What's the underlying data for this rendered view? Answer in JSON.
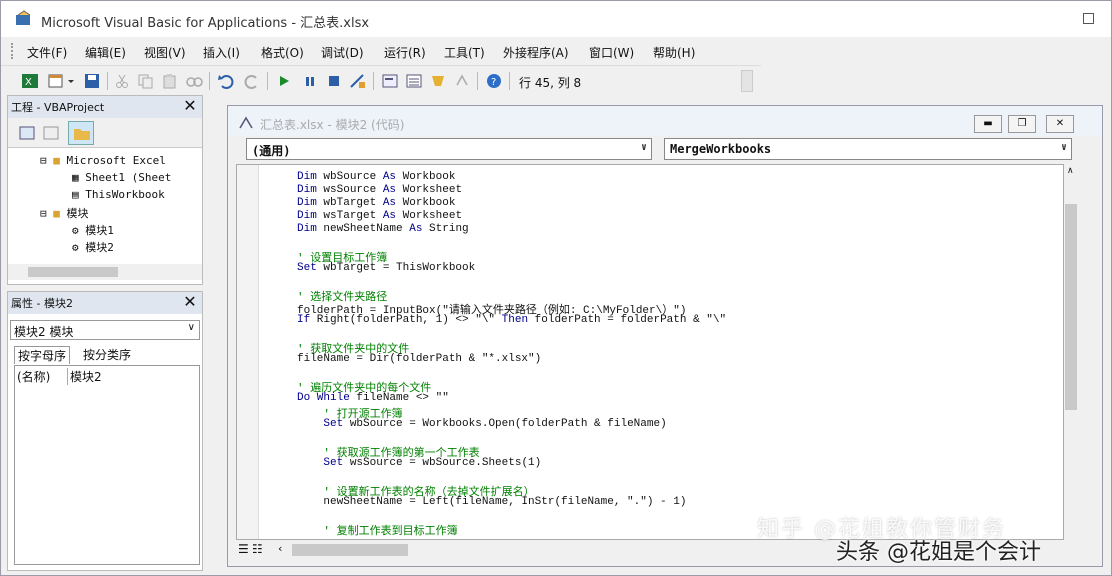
{
  "window": {
    "title": "Microsoft Visual Basic for Applications - 汇总表.xlsx"
  },
  "menu": [
    "文件(F)",
    "编辑(E)",
    "视图(V)",
    "插入(I)",
    "格式(O)",
    "调试(D)",
    "运行(R)",
    "工具(T)",
    "外接程序(A)",
    "窗口(W)",
    "帮助(H)"
  ],
  "toolbar": {
    "position_readout": "行 45, 列 8",
    "icons": [
      "excel-icon",
      "insert-module-icon",
      "save-icon",
      "cut-icon",
      "copy-icon",
      "paste-icon",
      "find-icon",
      "undo-icon",
      "redo-icon",
      "run-icon",
      "break-icon",
      "reset-icon",
      "design-mode-icon",
      "project-explorer-icon",
      "properties-icon",
      "object-browser-icon",
      "toolbox-icon",
      "help-icon"
    ]
  },
  "project_panel": {
    "title": "工程 - VBAProject",
    "tree": [
      {
        "label": "Microsoft Excel",
        "level": 1
      },
      {
        "label": "Sheet1 (Sheet",
        "level": 2
      },
      {
        "label": "ThisWorkbook",
        "level": 2
      },
      {
        "label": "模块",
        "level": 1
      },
      {
        "label": "模块1",
        "level": 2
      },
      {
        "label": "模块2",
        "level": 2
      }
    ]
  },
  "properties_panel": {
    "title": "属性 - 模块2",
    "selected_object": "模块2 模块",
    "tabs": [
      "按字母序",
      "按分类序"
    ],
    "prop_name": "(名称)",
    "prop_value": "模块2"
  },
  "code_window": {
    "title": "汇总表.xlsx - 模块2 (代码)",
    "object_combo": "(通用)",
    "procedure_combo": "MergeWorkbooks",
    "lines": [
      {
        "text": "Dim wbSource As Workbook",
        "type": "code"
      },
      {
        "text": "Dim wsSource As Worksheet",
        "type": "code"
      },
      {
        "text": "Dim wbTarget As Workbook",
        "type": "code"
      },
      {
        "text": "Dim wsTarget As Worksheet",
        "type": "code"
      },
      {
        "text": "Dim newSheetName As String",
        "type": "code"
      },
      {
        "text": "",
        "type": "blank"
      },
      {
        "text": "' 设置目标工作簿",
        "type": "comment"
      },
      {
        "text": "Set wbTarget = ThisWorkbook",
        "type": "code"
      },
      {
        "text": "",
        "type": "blank"
      },
      {
        "text": "' 选择文件夹路径",
        "type": "comment"
      },
      {
        "text": "folderPath = InputBox(\"请输入文件夹路径（例如: C:\\MyFolder\\）\")",
        "type": "code"
      },
      {
        "text": "If Right(folderPath, 1) <> \"\\\" Then folderPath = folderPath & \"\\\"",
        "type": "code"
      },
      {
        "text": "",
        "type": "blank"
      },
      {
        "text": "' 获取文件夹中的文件",
        "type": "comment"
      },
      {
        "text": "fileName = Dir(folderPath & \"*.xlsx\")",
        "type": "code"
      },
      {
        "text": "",
        "type": "blank"
      },
      {
        "text": "' 遍历文件夹中的每个文件",
        "type": "comment"
      },
      {
        "text": "Do While fileName <> \"\"",
        "type": "code"
      },
      {
        "text": "    ' 打开源工作簿",
        "type": "comment"
      },
      {
        "text": "    Set wbSource = Workbooks.Open(folderPath & fileName)",
        "type": "code"
      },
      {
        "text": "",
        "type": "blank"
      },
      {
        "text": "    ' 获取源工作簿的第一个工作表",
        "type": "comment"
      },
      {
        "text": "    Set wsSource = wbSource.Sheets(1)",
        "type": "code"
      },
      {
        "text": "",
        "type": "blank"
      },
      {
        "text": "    ' 设置新工作表的名称（去掉文件扩展名）",
        "type": "comment"
      },
      {
        "text": "    newSheetName = Left(fileName, InStr(fileName, \".\") - 1)",
        "type": "code"
      },
      {
        "text": "",
        "type": "blank"
      },
      {
        "text": "    ' 复制工作表到目标工作簿",
        "type": "comment"
      }
    ]
  },
  "watermarks": {
    "zhihu": "知乎 @花姐教你管财务",
    "toutiao": "头条 @花姐是个会计"
  }
}
